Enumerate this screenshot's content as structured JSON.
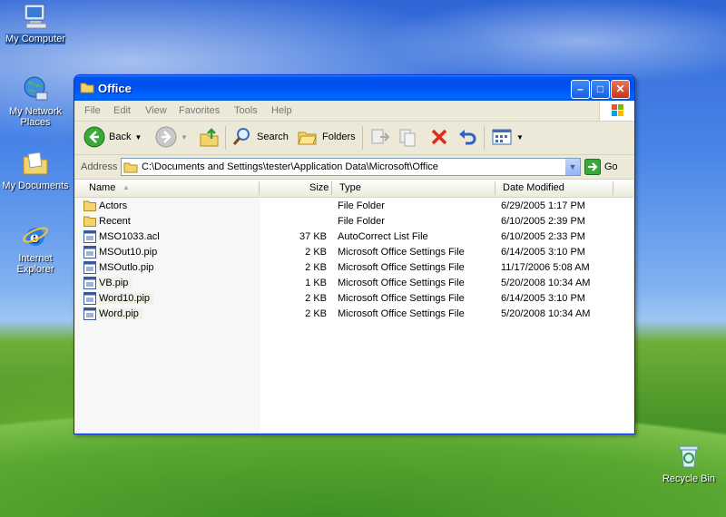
{
  "desktop": {
    "icons": [
      {
        "label": "My Computer",
        "name": "my-computer"
      },
      {
        "label": "My Network Places",
        "name": "my-network-places"
      },
      {
        "label": "My Documents",
        "name": "my-documents"
      },
      {
        "label": "Internet Explorer",
        "name": "internet-explorer"
      },
      {
        "label": "Recycle Bin",
        "name": "recycle-bin"
      }
    ]
  },
  "window": {
    "title": "Office",
    "minimize": "–",
    "maximize": "□",
    "close": "✕"
  },
  "menu": [
    "File",
    "Edit",
    "View",
    "Favorites",
    "Tools",
    "Help"
  ],
  "toolbar": {
    "back": "Back",
    "search": "Search",
    "folders": "Folders"
  },
  "address": {
    "label": "Address",
    "value": "C:\\Documents and Settings\\tester\\Application Data\\Microsoft\\Office",
    "go": "Go"
  },
  "columns": {
    "name": "Name",
    "size": "Size",
    "type": "Type",
    "date": "Date Modified"
  },
  "files": [
    {
      "name": "Actors",
      "size": "",
      "type": "File Folder",
      "date": "6/29/2005 1:17 PM",
      "kind": "folder",
      "selected": false
    },
    {
      "name": "Recent",
      "size": "",
      "type": "File Folder",
      "date": "6/10/2005 2:39 PM",
      "kind": "folder",
      "selected": false
    },
    {
      "name": "MSO1033.acl",
      "size": "37 KB",
      "type": "AutoCorrect List File",
      "date": "6/10/2005 2:33 PM",
      "kind": "file",
      "selected": false
    },
    {
      "name": "MSOut10.pip",
      "size": "2 KB",
      "type": "Microsoft Office Settings File",
      "date": "6/14/2005 3:10 PM",
      "kind": "file",
      "selected": false
    },
    {
      "name": "MSOutlo.pip",
      "size": "2 KB",
      "type": "Microsoft Office Settings File",
      "date": "11/17/2006 5:08 AM",
      "kind": "file",
      "selected": false
    },
    {
      "name": "VB.pip",
      "size": "1 KB",
      "type": "Microsoft Office Settings File",
      "date": "5/20/2008 10:34 AM",
      "kind": "file",
      "selected": true
    },
    {
      "name": "Word10.pip",
      "size": "2 KB",
      "type": "Microsoft Office Settings File",
      "date": "6/14/2005 3:10 PM",
      "kind": "file",
      "selected": true
    },
    {
      "name": "Word.pip",
      "size": "2 KB",
      "type": "Microsoft Office Settings File",
      "date": "5/20/2008 10:34 AM",
      "kind": "file",
      "selected": true
    }
  ],
  "colors": {
    "titlebar": "#0054e3",
    "selection": "#316ac5",
    "close_button": "#c2351a"
  }
}
